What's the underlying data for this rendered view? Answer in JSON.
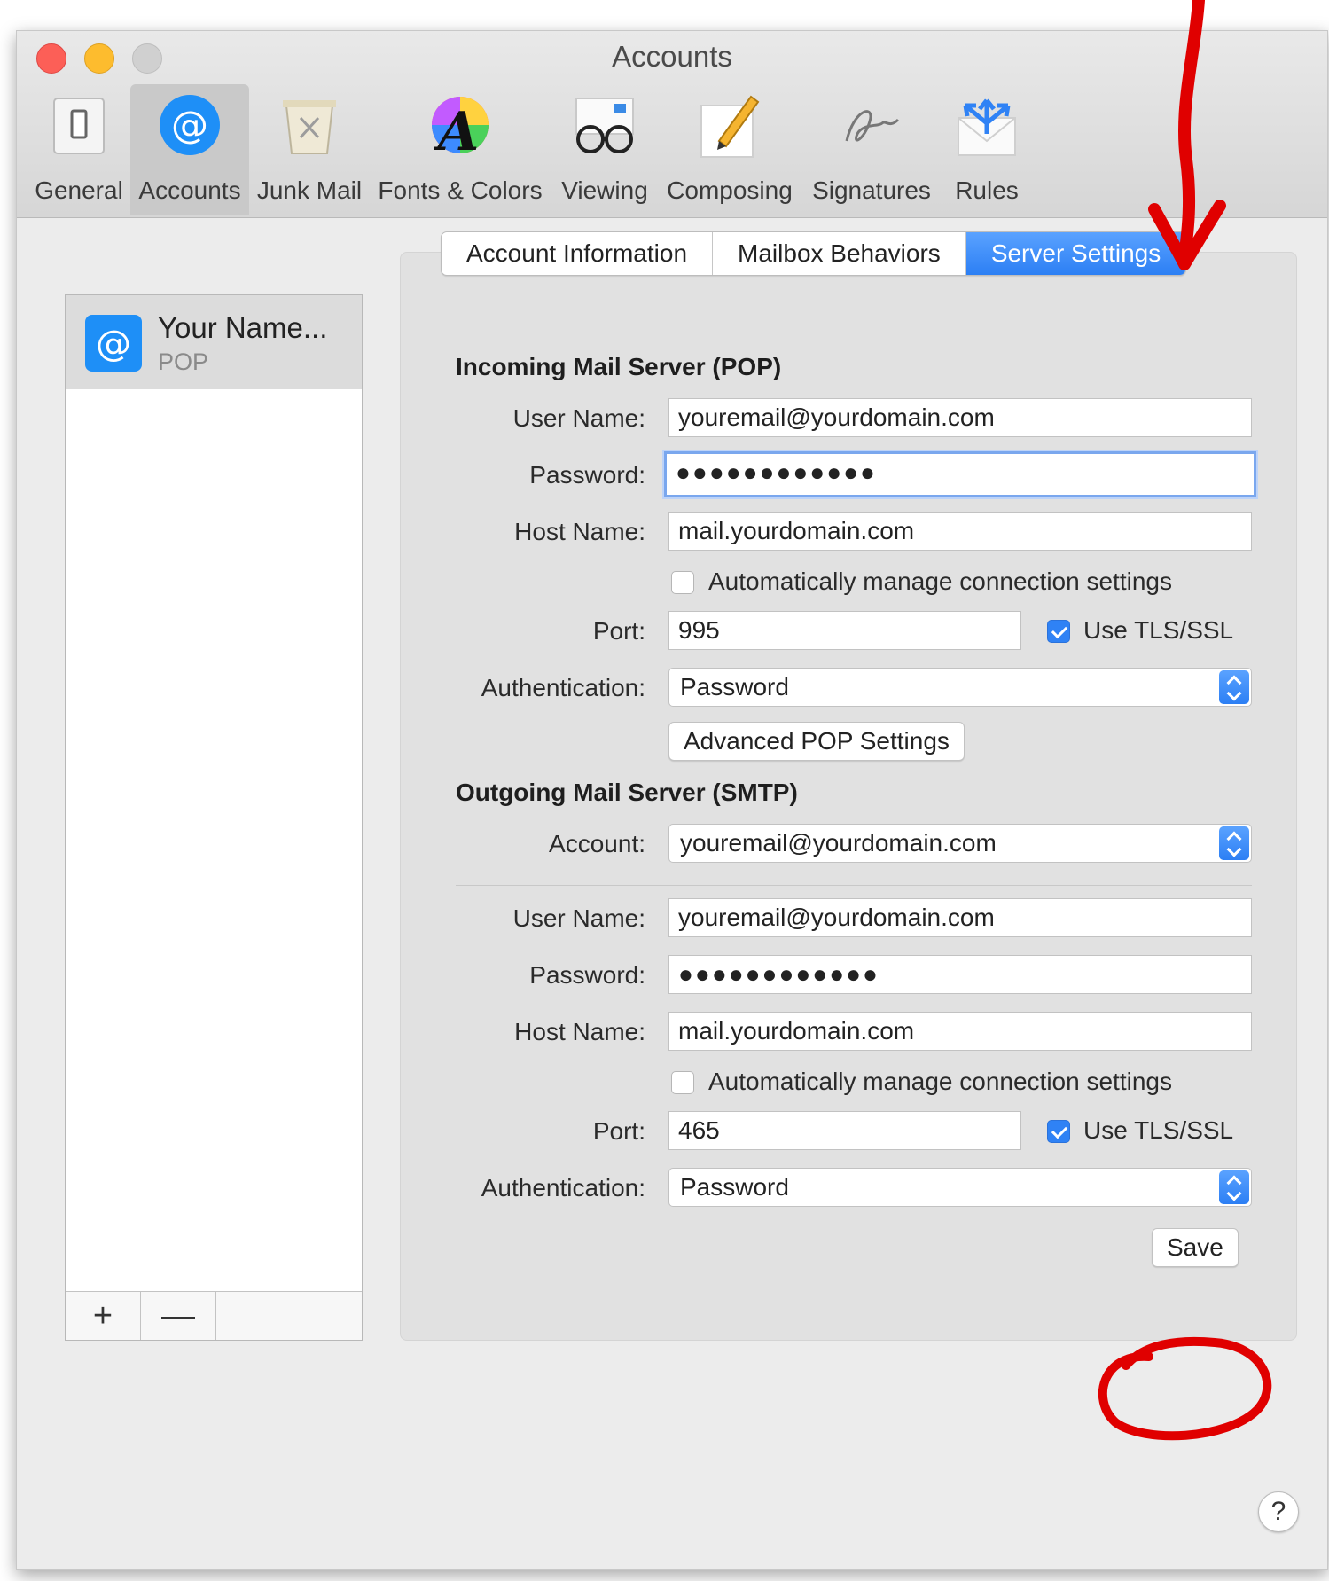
{
  "window": {
    "title": "Accounts"
  },
  "toolbar": {
    "items": [
      {
        "label": "General",
        "icon": "switch-icon"
      },
      {
        "label": "Accounts",
        "icon": "at-sign-icon"
      },
      {
        "label": "Junk Mail",
        "icon": "trash-bin-icon"
      },
      {
        "label": "Fonts & Colors",
        "icon": "font-colors-icon"
      },
      {
        "label": "Viewing",
        "icon": "glasses-icon"
      },
      {
        "label": "Composing",
        "icon": "pencil-paper-icon"
      },
      {
        "label": "Signatures",
        "icon": "signature-icon"
      },
      {
        "label": "Rules",
        "icon": "rules-envelope-icon"
      }
    ],
    "selected": "Accounts"
  },
  "sidebar": {
    "account": {
      "name": "Your Name...",
      "type": "POP"
    },
    "add_label": "+",
    "remove_label": "—"
  },
  "tabs": [
    {
      "label": "Account Information"
    },
    {
      "label": "Mailbox Behaviors"
    },
    {
      "label": "Server Settings",
      "active": true
    }
  ],
  "incoming": {
    "title": "Incoming Mail Server (POP)",
    "user_label": "User Name:",
    "user_value": "youremail@yourdomain.com",
    "password_label": "Password:",
    "password_value": "●●●●●●●●●●●●",
    "host_label": "Host Name:",
    "host_value": "mail.yourdomain.com",
    "auto_manage_label": "Automatically manage connection settings",
    "port_label": "Port:",
    "port_value": "995",
    "tls_label": "Use TLS/SSL",
    "auth_label": "Authentication:",
    "auth_value": "Password",
    "advanced_label": "Advanced POP Settings"
  },
  "outgoing": {
    "title": "Outgoing Mail Server (SMTP)",
    "account_label": "Account:",
    "account_value": "youremail@yourdomain.com",
    "user_label": "User Name:",
    "user_value": "youremail@yourdomain.com",
    "password_label": "Password:",
    "password_value": "●●●●●●●●●●●●",
    "host_label": "Host Name:",
    "host_value": "mail.yourdomain.com",
    "auto_manage_label": "Automatically manage connection settings",
    "port_label": "Port:",
    "port_value": "465",
    "tls_label": "Use TLS/SSL",
    "auth_label": "Authentication:",
    "auth_value": "Password"
  },
  "save_label": "Save",
  "help_label": "?",
  "colors": {
    "accent": "#2f82f5",
    "annotation": "#e00000"
  }
}
